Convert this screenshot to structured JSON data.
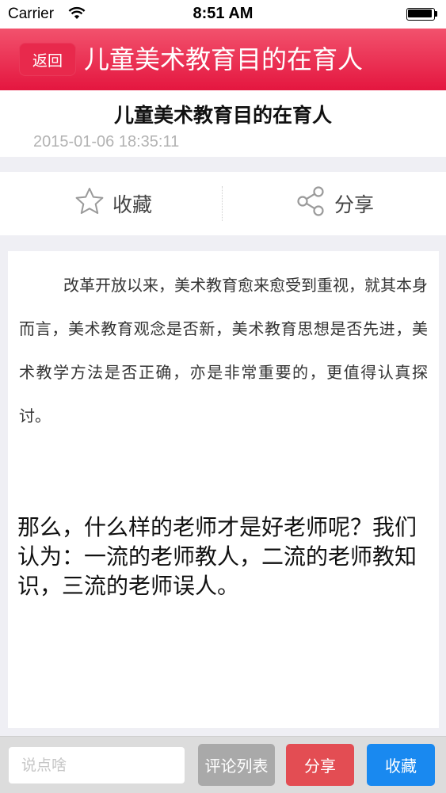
{
  "status_bar": {
    "carrier": "Carrier",
    "time": "8:51 AM",
    "wifi_icon": "wifi-icon",
    "battery_icon": "battery-icon"
  },
  "nav": {
    "back_label": "返回",
    "title": "儿童美术教育目的在育人",
    "accent_color": "#e8294c"
  },
  "article": {
    "title": "儿童美术教育目的在育人",
    "date": "2015-01-06 18:35:11",
    "paragraph_1": "改革开放以来，美术教育愈来愈受到重视，就其本身而言，美术教育观念是否新，美术教育思想是否先进，美术教学方法是否正确，亦是非常重要的，更值得认真探讨。",
    "paragraph_2": "那么，什么样的老师才是好老师呢？我们认为：一流的老师教人，二流的老师教知识，三流的老师误人。"
  },
  "actions": {
    "favorite_label": "收藏",
    "favorite_icon": "star-icon",
    "share_label": "分享",
    "share_icon": "share-icon"
  },
  "bottom_bar": {
    "comment_placeholder": "说点啥",
    "comment_value": "",
    "comments_list_label": "评论列表",
    "share_label": "分享",
    "favorite_label": "收藏",
    "colors": {
      "comments_list": "#a9a9a9",
      "share": "#e34d53",
      "favorite": "#1989f0"
    }
  }
}
